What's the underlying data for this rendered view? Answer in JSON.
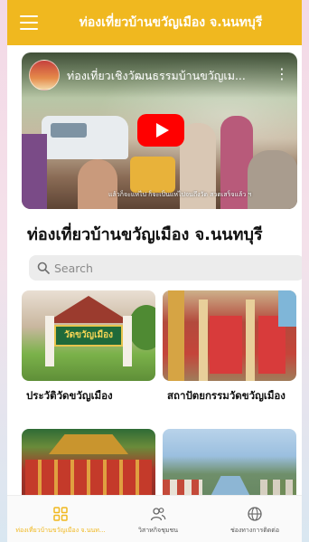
{
  "app": {
    "title": "ท่องเที่ยวบ้านขวัญเมือง จ.นนทบุรี",
    "accent_color": "#f0b81f",
    "menu_icon": "hamburger-menu-icon"
  },
  "video": {
    "title": "ท่องเที่ยวเชิงวัฒนธรรมบ้านขวัญเม...",
    "caption": "แล้วก็จะแห่ไป ก็จะเป็นแห่ไปจนถึงวัด สวดเสร็จแล้ว ฯ",
    "play_icon": "youtube-play-icon",
    "more_icon": "more-vertical-icon"
  },
  "section": {
    "title": "ท่องเที่ยวบ้านขวัญเมือง จ.นนทบุรี"
  },
  "search": {
    "placeholder": "Search",
    "value": "",
    "icon": "search-icon"
  },
  "cards": [
    {
      "label": "ประวัติวัดขวัญเมือง",
      "sign_text": "วัดขวัญเมือง"
    },
    {
      "label": "สถาปัตยกรรมวัดขวัญเมือง"
    },
    {
      "label": ""
    },
    {
      "label": ""
    }
  ],
  "bottom_nav": {
    "items": [
      {
        "label": "ท่องเที่ยวบ้านขวัญเมือง จ.นนท...",
        "icon": "grid-icon",
        "active": true
      },
      {
        "label": "วิสาหกิจชุมชน",
        "icon": "people-icon",
        "active": false
      },
      {
        "label": "ช่องทางการติดต่อ",
        "icon": "globe-icon",
        "active": false
      }
    ]
  }
}
